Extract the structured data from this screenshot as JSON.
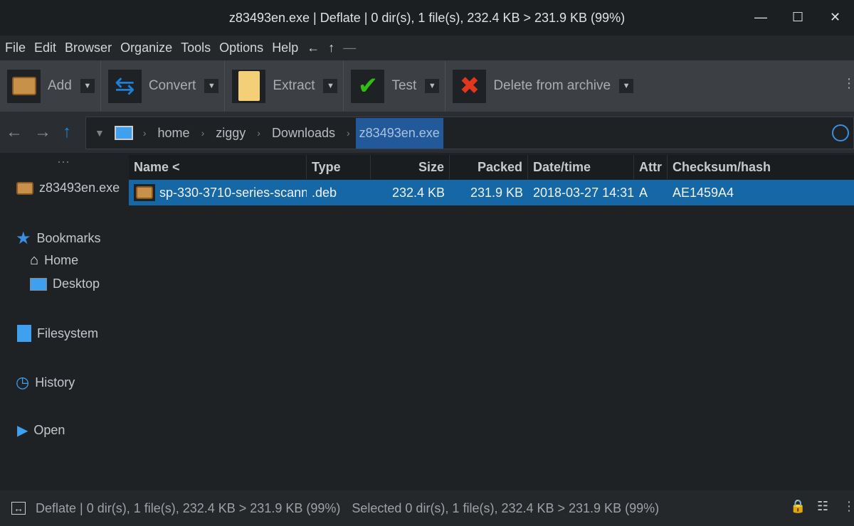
{
  "window": {
    "title": "z83493en.exe | Deflate | 0 dir(s), 1 file(s), 232.4 KB > 231.9 KB (99%)",
    "minimize": "—",
    "maximize": "☐",
    "close": "✕"
  },
  "menu": [
    "File",
    "Edit",
    "Browser",
    "Organize",
    "Tools",
    "Options",
    "Help",
    "←",
    "↑",
    "—"
  ],
  "toolbar": [
    {
      "label": "Add",
      "icon": "add-archive-icon"
    },
    {
      "label": "Convert",
      "icon": "convert-icon"
    },
    {
      "label": "Extract",
      "icon": "extract-icon"
    },
    {
      "label": "Test",
      "icon": "test-checkmark-icon"
    },
    {
      "label": "Delete from archive",
      "icon": "delete-x-icon"
    }
  ],
  "address": {
    "crumbs": [
      "home",
      "ziggy",
      "Downloads"
    ],
    "current": "z83493en.exe"
  },
  "sidebar": {
    "archive": "z83493en.exe",
    "bookmarks": "Bookmarks",
    "home": "Home",
    "desktop": "Desktop",
    "filesystem": "Filesystem",
    "history": "History",
    "open": "Open"
  },
  "table": {
    "columns": [
      "Name <",
      "Type",
      "Size",
      "Packed",
      "Date/time",
      "Attr",
      "Checksum/hash"
    ],
    "rows": [
      {
        "name": "sp-330-3710-series-scann",
        "type": ".deb",
        "size": "232.4 KB",
        "packed": "231.9 KB",
        "date": "2018-03-27 14:31",
        "attr": "A",
        "hash": "AE1459A4"
      }
    ]
  },
  "status": {
    "info": "Deflate | 0 dir(s), 1 file(s), 232.4 KB > 231.9 KB (99%)",
    "selected": "Selected 0 dir(s), 1 file(s), 232.4 KB > 231.9 KB (99%)"
  }
}
